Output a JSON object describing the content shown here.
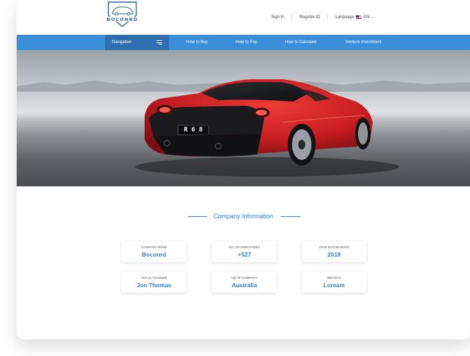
{
  "brand": {
    "logo_text": "BOCONRD"
  },
  "top_links": {
    "sign_in": "Sign In",
    "register": "Register ID",
    "language_label": "Language",
    "language_code": "EN"
  },
  "nav": {
    "toggle_label": "Navigation",
    "items": [
      "How to Buy",
      "How to Pay",
      "How to Calculate",
      "Venture Investment"
    ]
  },
  "hero": {
    "plate": "R 6 8"
  },
  "company": {
    "title": "Company Information",
    "items": [
      {
        "label": "COMPANY NAME",
        "value": "Boconrd"
      },
      {
        "label": "NO. OF EMPLOYEES",
        "value": "+527"
      },
      {
        "label": "YEAR ESTABLISHED",
        "value": "2018"
      },
      {
        "label": "CEO & FOUNDER",
        "value": "Jon Thomas"
      },
      {
        "label": "HQ OF COMPANY",
        "value": "Australia"
      },
      {
        "label": "BRANCH",
        "value": "Loream"
      }
    ]
  },
  "colors": {
    "nav_bar": "#3b8ed8",
    "nav_toggle": "#2f6fb0",
    "accent": "#2f7fd0",
    "car": "#c81e22"
  }
}
